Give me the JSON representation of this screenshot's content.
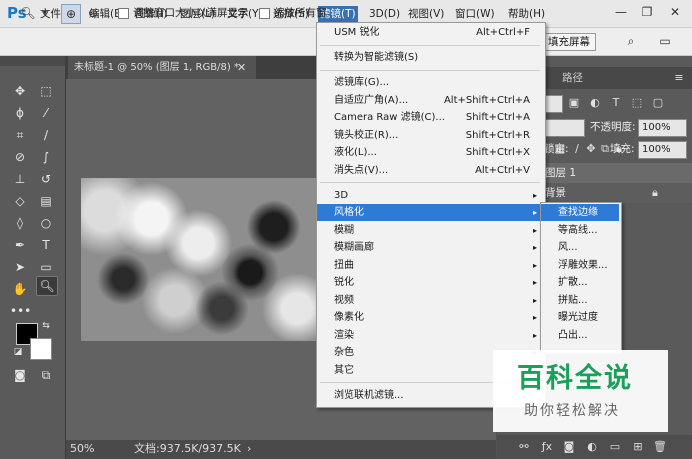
{
  "app": {
    "logo": "Ps"
  },
  "menubar": {
    "items": [
      "文件(F)",
      "编辑(E)",
      "图像(I)",
      "图层(L)",
      "文字(Y)",
      "选择(S)",
      "滤镜(T)",
      "3D(D)",
      "视图(V)",
      "窗口(W)",
      "帮助(H)"
    ],
    "active": "滤镜(T)",
    "window_controls": [
      "—",
      "❐",
      "✕"
    ]
  },
  "options_bar": {
    "resize_windows_label": "调整窗口大小以满屏显示",
    "zoom_all_label": "缩放所有窗",
    "fill_screen_label": "填充屏幕"
  },
  "document": {
    "tab_title": "未标题-1 @ 50% (图层 1, RGB/8) *",
    "close_glyph": "✕",
    "zoom": "50%",
    "doc_size": "文档:937.5K/937.5K",
    "status_arrow": "›"
  },
  "filter_menu": {
    "items": [
      {
        "label": "USM 锐化",
        "shortcut": "Alt+Ctrl+F"
      },
      {
        "label": "转换为智能滤镜(S)",
        "shortcut": ""
      },
      {
        "label": "滤镜库(G)...",
        "shortcut": ""
      },
      {
        "label": "自适应广角(A)...",
        "shortcut": "Alt+Shift+Ctrl+A"
      },
      {
        "label": "Camera Raw 滤镜(C)...",
        "shortcut": "Shift+Ctrl+A"
      },
      {
        "label": "镜头校正(R)...",
        "shortcut": "Shift+Ctrl+R"
      },
      {
        "label": "液化(L)...",
        "shortcut": "Shift+Ctrl+X"
      },
      {
        "label": "消失点(V)...",
        "shortcut": "Alt+Ctrl+V"
      },
      {
        "label": "3D",
        "shortcut": ""
      },
      {
        "label": "风格化",
        "shortcut": ""
      },
      {
        "label": "模糊",
        "shortcut": ""
      },
      {
        "label": "模糊画廊",
        "shortcut": ""
      },
      {
        "label": "扭曲",
        "shortcut": ""
      },
      {
        "label": "锐化",
        "shortcut": ""
      },
      {
        "label": "视频",
        "shortcut": ""
      },
      {
        "label": "像素化",
        "shortcut": ""
      },
      {
        "label": "渲染",
        "shortcut": ""
      },
      {
        "label": "杂色",
        "shortcut": ""
      },
      {
        "label": "其它",
        "shortcut": ""
      },
      {
        "label": "浏览联机滤镜...",
        "shortcut": ""
      }
    ],
    "submenu_arrow": "▸",
    "highlighted": "风格化"
  },
  "stylize_submenu": {
    "items": [
      "查找边缘",
      "等高线...",
      "风...",
      "浮雕效果...",
      "扩散...",
      "拼贴...",
      "曝光过度",
      "凸出..."
    ],
    "highlighted": "查找边缘"
  },
  "panels": {
    "paths_tab": "路径",
    "opacity_label": "不透明度:",
    "opacity_value": "100%",
    "lock_label": "锁定:",
    "fill_label": "填充:",
    "fill_value": "100%",
    "layers": [
      "图层 1",
      "背景"
    ]
  },
  "watermark": {
    "logo": "百科全说",
    "slogan": "助你轻松解决"
  },
  "colors": {
    "menu_highlight": "#2d7bd6",
    "ps_blue": "#1c79c8",
    "watermark_green": "#1aa05a"
  }
}
